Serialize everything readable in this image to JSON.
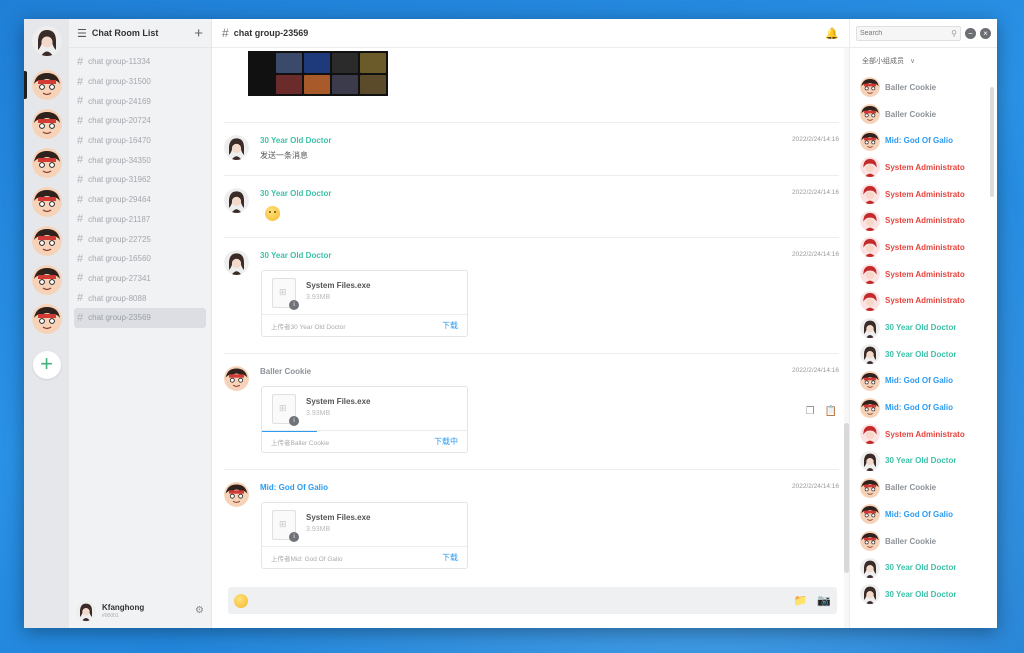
{
  "colors": {
    "teal": "#3ec1a8",
    "blue": "#2d9bf0",
    "red": "#e5443d",
    "gray_name": "#8d9399",
    "link": "#2d9bf0"
  },
  "sidebar": {
    "title": "Chat Room List",
    "channels": [
      "chat group-11334",
      "chat group-31500",
      "chat group-24169",
      "chat group-20724",
      "chat group-16470",
      "chat group-34350",
      "chat group-31962",
      "chat group-29464",
      "chat group-21187",
      "chat group-22725",
      "chat group-16560",
      "chat group-27341",
      "chat group-8088",
      "chat group-23569"
    ],
    "active_index": 13
  },
  "user": {
    "name": "Kfanghong",
    "tag": "#00001"
  },
  "chat": {
    "title": "chat group-23569",
    "input_value": "",
    "messages": [
      {
        "sender": "30 Year Old Doctor",
        "time": "2022/2/24/14:16",
        "text": "发送一条消息"
      },
      {
        "sender": "30 Year Old Doctor",
        "time": "2022/2/24/14:16"
      },
      {
        "sender": "30 Year Old Doctor",
        "time": "2022/2/24/14:16",
        "file_name": "System Files.exe",
        "file_size": "3.93MB",
        "uploader": "上传者30 Year Old Doctor",
        "download": "下载"
      },
      {
        "sender": "Baller Cookie",
        "time": "2022/2/24/14:16",
        "file_name": "System Files.exe",
        "file_size": "3.93MB",
        "uploader": "上传者Baller Cookie",
        "download": "下载中",
        "progress": 0.27
      },
      {
        "sender": "Mid: God Of Galio",
        "time": "2022/2/24/14:16",
        "file_name": "System Files.exe",
        "file_size": "3.93MB",
        "uploader": "上传者Mid: God Of Galio",
        "download": "下载"
      }
    ]
  },
  "members": {
    "search_placeholder": "Search",
    "filter_label": "全部小组成员",
    "list": [
      {
        "name": "Baller Cookie",
        "color": "#8d9399"
      },
      {
        "name": "Baller Cookie",
        "color": "#8d9399"
      },
      {
        "name": "Mid: God Of Galio",
        "color": "#2d9bf0"
      },
      {
        "name": "System Administrato",
        "color": "#e5443d"
      },
      {
        "name": "System Administrato",
        "color": "#e5443d"
      },
      {
        "name": "System Administrato",
        "color": "#e5443d"
      },
      {
        "name": "System Administrato",
        "color": "#e5443d"
      },
      {
        "name": "System Administrato",
        "color": "#e5443d"
      },
      {
        "name": "System Administrato",
        "color": "#e5443d"
      },
      {
        "name": "30 Year Old Doctor",
        "color": "#3ec1a8"
      },
      {
        "name": "30 Year Old Doctor",
        "color": "#3ec1a8"
      },
      {
        "name": "Mid: God Of Galio",
        "color": "#2d9bf0"
      },
      {
        "name": "Mid: God Of Galio",
        "color": "#2d9bf0"
      },
      {
        "name": "System Administrato",
        "color": "#e5443d"
      },
      {
        "name": "30 Year Old Doctor",
        "color": "#3ec1a8"
      },
      {
        "name": "Baller Cookie",
        "color": "#8d9399"
      },
      {
        "name": "Mid: God Of Galio",
        "color": "#2d9bf0"
      },
      {
        "name": "Baller Cookie",
        "color": "#8d9399"
      },
      {
        "name": "30 Year Old Doctor",
        "color": "#3ec1a8"
      },
      {
        "name": "30 Year Old Doctor",
        "color": "#3ec1a8"
      }
    ]
  }
}
